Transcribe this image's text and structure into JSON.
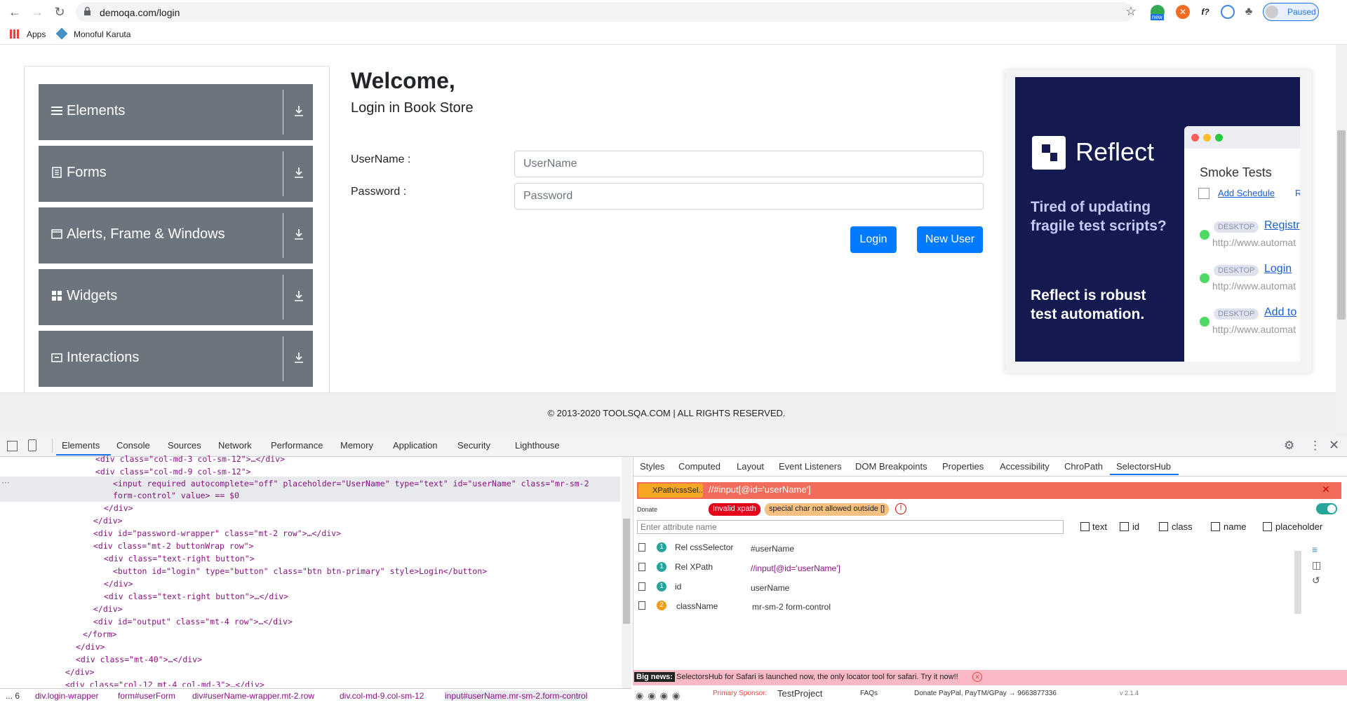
{
  "browser": {
    "url": "demoqa.com/login",
    "bookmarks": [
      "Apps",
      "Monoful Karuta"
    ],
    "profile_status": "Paused",
    "ext_f": "f?",
    "ext_badge": "new"
  },
  "sidebar": {
    "groups": [
      "Elements",
      "Forms",
      "Alerts, Frame & Windows",
      "Widgets",
      "Interactions"
    ]
  },
  "login": {
    "heading": "Welcome,",
    "subheading": "Login in Book Store",
    "username_label": "UserName :",
    "password_label": "Password :",
    "username_placeholder": "UserName",
    "password_placeholder": "Password",
    "login_button": "Login",
    "new_user_button": "New User"
  },
  "ad": {
    "brand": "Reflect",
    "headline": "Tired of updating fragile test scripts?",
    "tagline": "Reflect is robust test automation.",
    "panel_title": "Smoke Tests",
    "add_schedule": "Add Schedule",
    "run_link": "Ru",
    "rows": [
      {
        "tag": "DESKTOP",
        "name": "Registr",
        "url": "http://www.automat"
      },
      {
        "tag": "DESKTOP",
        "name": "Login",
        "url": "http://www.automat"
      },
      {
        "tag": "DESKTOP",
        "name": "Add to",
        "url": "http://www.automat"
      }
    ]
  },
  "footer": {
    "copyright": "© 2013-2020 TOOLSQA.COM | ALL RIGHTS RESERVED."
  },
  "devtools": {
    "tabs": [
      "Elements",
      "Console",
      "Sources",
      "Network",
      "Performance",
      "Memory",
      "Application",
      "Security",
      "Lighthouse"
    ],
    "right_tabs": [
      "Styles",
      "Computed",
      "Layout",
      "Event Listeners",
      "DOM Breakpoints",
      "Properties",
      "Accessibility",
      "ChroPath",
      "SelectorsHub"
    ],
    "code_lines": [
      "<div class=\"col-md-3 col-sm-12\">…</div>",
      "<div class=\"col-md-9 col-sm-12\">",
      "<input required autocomplete=\"off\" placeholder=\"UserName\" type=\"text\" id=\"userName\" class=\"mr-sm-2",
      "form-control\" value> == $0",
      "</div>",
      "</div>",
      "<div id=\"password-wrapper\" class=\"mt-2 row\">…</div>",
      "<div class=\"mt-2 buttonWrap row\">",
      "<div class=\"text-right button\">",
      "<button id=\"login\" type=\"button\" class=\"btn btn-primary\" style>Login</button>",
      "</div>",
      "<div class=\"text-right button\">…</div>",
      "</div>",
      "<div id=\"output\" class=\"mt-4 row\">…</div>",
      "</form>",
      "</div>",
      "<div class=\"mt-40\">…</div>",
      "</div>",
      "<div class=\"col-12 mt-4 col-md-3\">…</div>"
    ],
    "breadcrumb": [
      "... 6",
      "div.login-wrapper",
      "form#userForm",
      "div#userName-wrapper.mt-2.row",
      "div.col-md-9.col-sm-12",
      "input#userName.mr-sm-2.form-control"
    ],
    "selectorshub": {
      "selector_type": "XPath/cssSel..",
      "query": "//#input[@id='userName']",
      "donate": "Donate",
      "error1": "Invalid xpath",
      "error2": "special char not allowed outside []",
      "attr_placeholder": "Enter attribute name",
      "checks": [
        "text",
        "id",
        "class",
        "name",
        "placeholder"
      ],
      "results": [
        {
          "count": "1",
          "name": "Rel cssSelector",
          "value": "#userName"
        },
        {
          "count": "1",
          "name": "Rel XPath",
          "value": "//input[@id='userName']"
        },
        {
          "count": "1",
          "name": "id",
          "value": "userName"
        },
        {
          "count": "2",
          "name": "className",
          "value": "mr-sm-2 form-control"
        }
      ],
      "big_news_label": "Big news:",
      "big_news": "SelectorsHub for Safari is launched now, the only locator tool for safari. Try it now!!",
      "sponsor_label": "Primary Sponsor:",
      "sponsor": "TestProject",
      "faqs": "FAQs",
      "donate_info": "Donate PayPal, PayTM/GPay → 9663877336",
      "version": "v 2.1.4"
    }
  }
}
